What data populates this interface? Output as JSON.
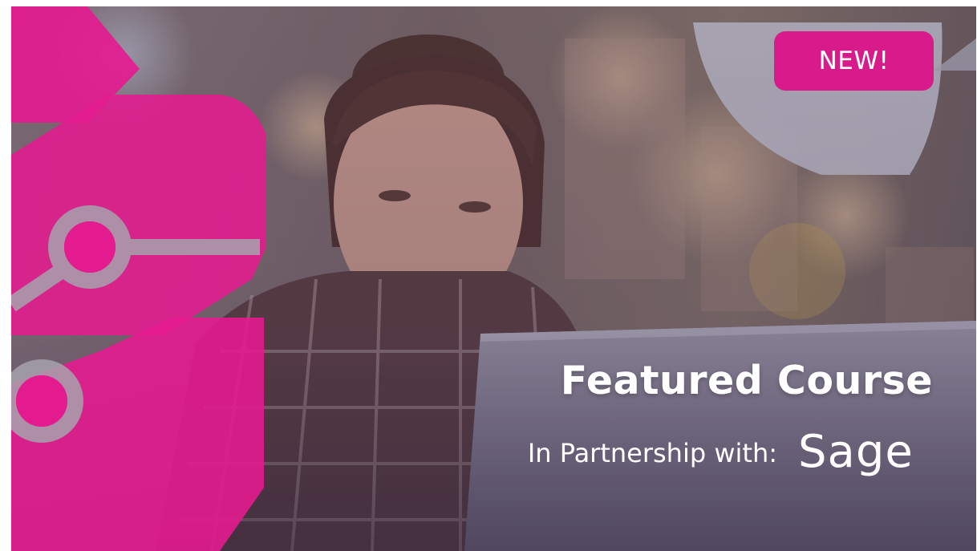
{
  "badge": {
    "label": "NEW!"
  },
  "headline": {
    "title": "Featured Course"
  },
  "partnership": {
    "label": "In Partnership with:",
    "logo_text": "Sage"
  },
  "colors": {
    "brand_pink": "#d81a8b",
    "overlay": "#5a4f5a",
    "text": "#ffffff"
  }
}
